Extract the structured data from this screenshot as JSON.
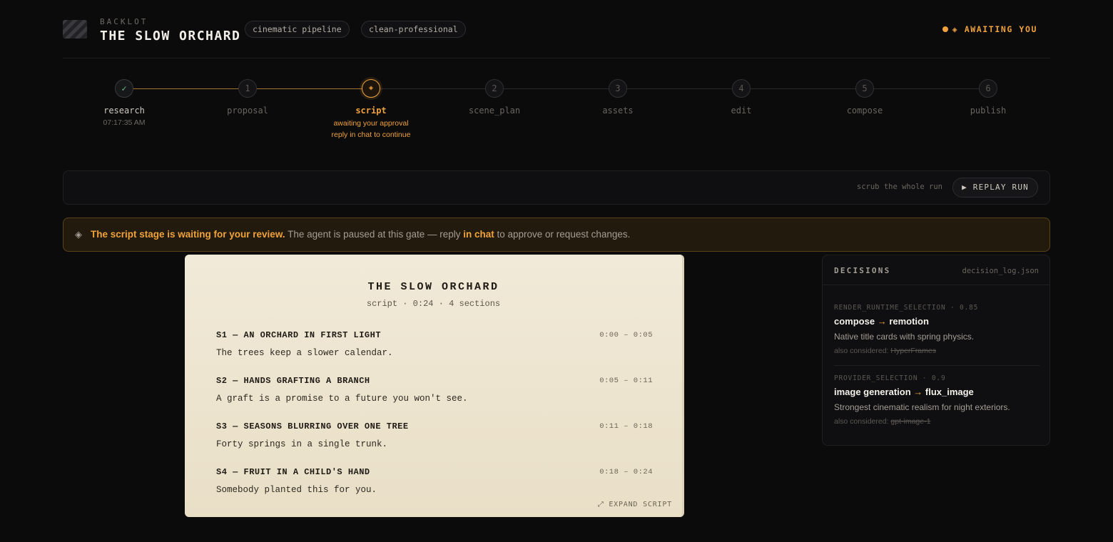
{
  "header": {
    "brand": "BACKLOT",
    "title": "THE SLOW ORCHARD",
    "chips": [
      "cinematic pipeline",
      "clean-professional"
    ],
    "status": "◈ AWAITING YOU"
  },
  "stepper": {
    "steps": [
      {
        "marker": "✓",
        "label": "research",
        "sub": "07:17:35 AM",
        "state": "done"
      },
      {
        "marker": "1",
        "label": "proposal",
        "sub": "",
        "state": "pending"
      },
      {
        "marker": "◈",
        "label": "script",
        "sub": "awaiting your approval",
        "sub2": "reply in chat to continue",
        "state": "active"
      },
      {
        "marker": "2",
        "label": "scene_plan",
        "sub": "",
        "state": "pending"
      },
      {
        "marker": "3",
        "label": "assets",
        "sub": "",
        "state": "pending"
      },
      {
        "marker": "4",
        "label": "edit",
        "sub": "",
        "state": "pending"
      },
      {
        "marker": "5",
        "label": "compose",
        "sub": "",
        "state": "pending"
      },
      {
        "marker": "6",
        "label": "publish",
        "sub": "",
        "state": "pending"
      }
    ]
  },
  "replay": {
    "hint": "scrub the whole run",
    "button": "▶ REPLAY RUN"
  },
  "alert": {
    "icon": "◈",
    "strong": "The script stage is waiting for your review.",
    "text1": " The agent is paused at this gate — reply ",
    "highlight": "in chat",
    "text2": " to approve or request changes."
  },
  "script": {
    "title": "THE SLOW ORCHARD",
    "meta": "script · 0:24 · 4 sections",
    "sections": [
      {
        "heading": "S1 — AN ORCHARD IN FIRST LIGHT",
        "time": "0:00 – 0:05",
        "line": "The trees keep a slower calendar."
      },
      {
        "heading": "S2 — HANDS GRAFTING A BRANCH",
        "time": "0:05 – 0:11",
        "line": "A graft is a promise to a future you won't see."
      },
      {
        "heading": "S3 — SEASONS BLURRING OVER ONE TREE",
        "time": "0:11 – 0:18",
        "line": "Forty springs in a single trunk."
      },
      {
        "heading": "S4 — FRUIT IN A CHILD'S HAND",
        "time": "0:18 – 0:24",
        "line": "Somebody planted this for you."
      }
    ],
    "expand": "⤢ EXPAND SCRIPT"
  },
  "decisions": {
    "title": "DECISIONS",
    "file": "decision_log.json",
    "items": [
      {
        "key": "RENDER_RUNTIME_SELECTION · 0.85",
        "stage": "compose",
        "arrow": " → ",
        "choice": "remotion",
        "why": "Native title cards with spring physics.",
        "alt_label": "also considered: ",
        "alt": "HyperFrames"
      },
      {
        "key": "PROVIDER_SELECTION · 0.9",
        "stage": "image generation",
        "arrow": " → ",
        "choice": "flux_image",
        "why": "Strongest cinematic realism for night exteriors.",
        "alt_label": "also considered: ",
        "alt": "gpt-image-1"
      }
    ]
  },
  "colors": {
    "accent": "#f0a23c",
    "done": "#6bbf8a",
    "background": "#0b0b0c",
    "paper": "#f1ead8"
  }
}
